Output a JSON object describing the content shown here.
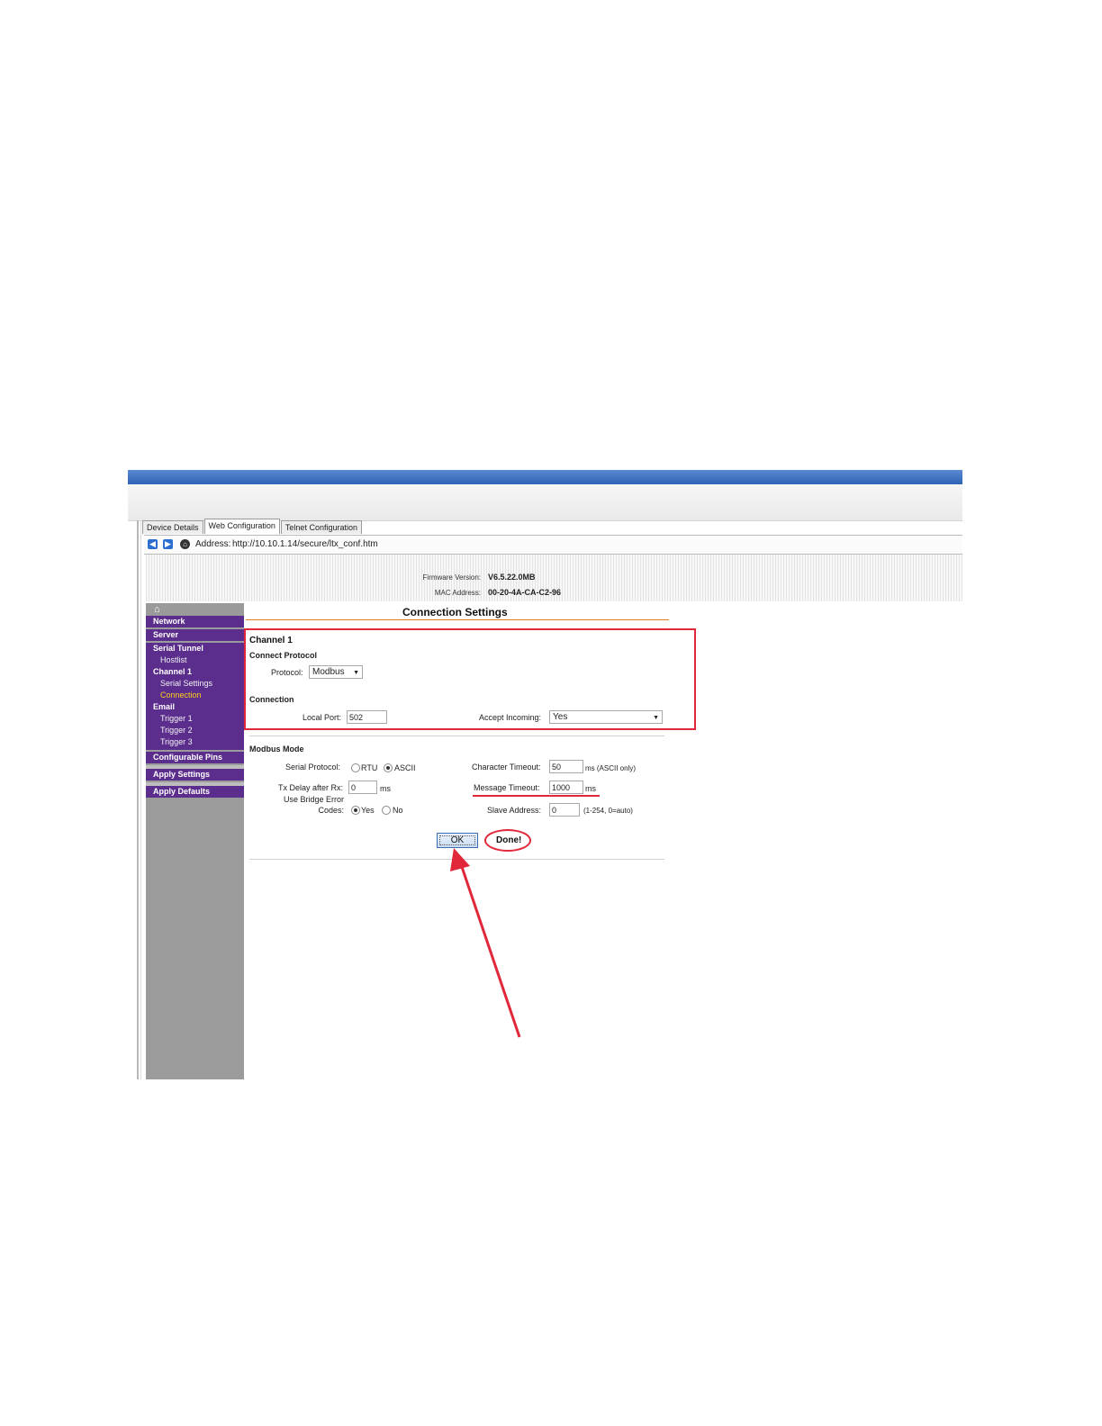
{
  "tabs": [
    {
      "label": "Device Details"
    },
    {
      "label": "Web Configuration"
    },
    {
      "label": "Telnet Configuration"
    }
  ],
  "address_bar": {
    "label": "Address:",
    "url": "http://10.10.1.14/secure/ltx_conf.htm"
  },
  "header": {
    "firmware_label": "Firmware Version:",
    "firmware_value": "V6.5.22.0MB",
    "mac_label": "MAC Address:",
    "mac_value": "00-20-4A-CA-C2-96"
  },
  "sidebar": {
    "network": "Network",
    "server": "Server",
    "serial_tunnel": "Serial Tunnel",
    "hostlist": "Hostlist",
    "channel1": "Channel 1",
    "serial_settings": "Serial Settings",
    "connection": "Connection",
    "email": "Email",
    "trigger1": "Trigger 1",
    "trigger2": "Trigger 2",
    "trigger3": "Trigger 3",
    "configurable_pins": "Configurable Pins",
    "apply_settings": "Apply Settings",
    "apply_defaults": "Apply Defaults"
  },
  "page": {
    "title": "Connection Settings",
    "channel_title": "Channel 1",
    "connect_protocol_title": "Connect Protocol",
    "protocol_label": "Protocol:",
    "protocol_value": "Modbus",
    "connection_title": "Connection",
    "local_port_label": "Local Port:",
    "local_port_value": "502",
    "accept_incoming_label": "Accept Incoming:",
    "accept_incoming_value": "Yes",
    "modbus_mode_title": "Modbus Mode",
    "serial_protocol_label": "Serial Protocol:",
    "rtu_label": "RTU",
    "ascii_label": "ASCII",
    "tx_delay_label": "Tx Delay after Rx:",
    "tx_delay_value": "0",
    "tx_delay_unit": "ms",
    "bridge_label_line1": "Use Bridge Error",
    "bridge_label_line2": "Codes:",
    "yes_label": "Yes",
    "no_label": "No",
    "char_timeout_label": "Character Timeout:",
    "char_timeout_value": "50",
    "char_timeout_unit": "ms (ASCII only)",
    "msg_timeout_label": "Message Timeout:",
    "msg_timeout_value": "1000",
    "msg_timeout_unit": "ms",
    "slave_addr_label": "Slave Address:",
    "slave_addr_value": "0",
    "slave_addr_hint": "(1-254, 0=auto)",
    "ok_label": "OK",
    "done_label": "Done!"
  },
  "colors": {
    "sidebar_purple": "#5b2d8c",
    "annotation_red": "#e0283a",
    "title_rule_orange": "#e07b1e",
    "active_link_yellow": "#ffd21a"
  }
}
